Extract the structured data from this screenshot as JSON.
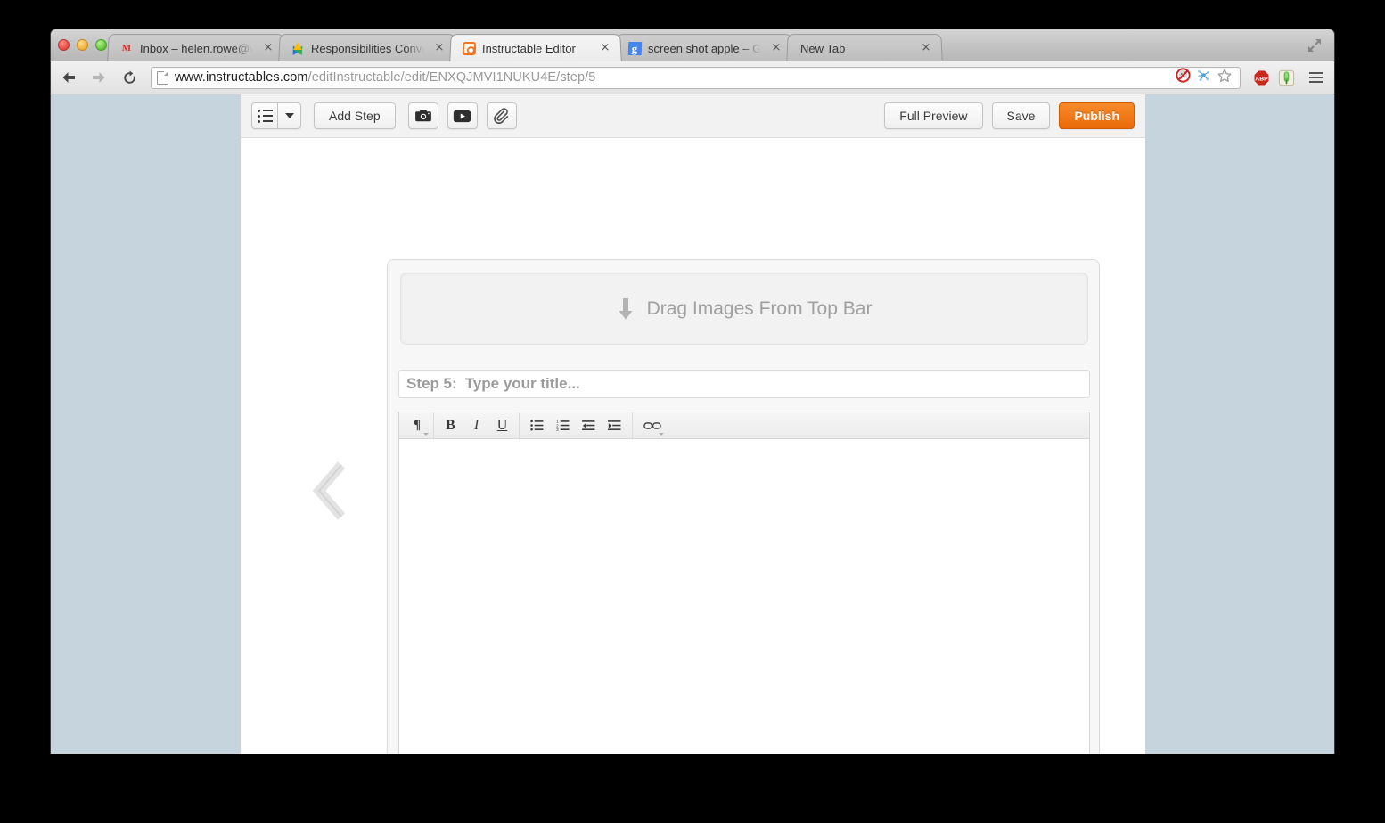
{
  "browser": {
    "window_controls": [
      "close",
      "minimize",
      "zoom"
    ],
    "fullscreen_icon": "fullscreen-expand-icon",
    "tabs": [
      {
        "title": "Inbox – helen.rowe@works",
        "favicon": "gmail-icon",
        "active": false,
        "close_label": "×"
      },
      {
        "title": "Responsibilities Conventio",
        "favicon": "google-drive-icon",
        "active": false,
        "close_label": "×"
      },
      {
        "title": "Instructable Editor",
        "favicon": "instructables-icon",
        "active": true,
        "close_label": "×"
      },
      {
        "title": "screen shot apple – Google",
        "favicon": "google-icon",
        "active": false,
        "close_label": "×"
      },
      {
        "title": "New Tab",
        "favicon": "none",
        "active": false,
        "close_label": "×"
      }
    ],
    "nav": {
      "back_icon": "back-arrow-icon",
      "forward_icon": "forward-arrow-icon",
      "reload_icon": "reload-icon"
    },
    "omnibox": {
      "page_icon": "page-document-icon",
      "url_host": "www.instructables.com",
      "url_path": "/editInstructable/edit/ENXQJMVI1NUKU4E/step/5",
      "full_url": "www.instructables.com/editInstructable/edit/ENXQJMVI1NUKU4E/step/5",
      "inline_icons": [
        "ghostery-icon",
        "collusion-icon",
        "bookmark-star-icon"
      ]
    },
    "extensions": [
      {
        "name": "adblock-plus-icon",
        "label": "ABP",
        "color": "#c9291d"
      },
      {
        "name": "evernote-clipper-icon",
        "label": "",
        "color": "#7ac143"
      }
    ],
    "menu_icon": "hamburger-menu-icon"
  },
  "editor_toolbar": {
    "list_view_icon": "bulleted-list-icon",
    "list_view_caret_icon": "chevron-down-icon",
    "add_step_label": "Add Step",
    "camera_icon": "camera-icon",
    "video_icon": "video-play-icon",
    "attach_icon": "paperclip-icon",
    "full_preview_label": "Full Preview",
    "save_label": "Save",
    "publish_label": "Publish",
    "publish_color": "#ea6a09"
  },
  "step": {
    "dropzone": {
      "arrow_icon": "down-arrow-icon",
      "label": "Drag Images From Top Bar"
    },
    "title_field": {
      "prefix": "Step 5:",
      "placeholder": "Type your title..."
    },
    "rte": {
      "paragraph_icon": "pilcrow-icon",
      "paragraph_glyph": "¶",
      "bold_label": "B",
      "italic_label": "I",
      "underline_label": "U",
      "bullet_list_icon": "bulleted-list-icon",
      "numbered_list_icon": "numbered-list-icon",
      "outdent_icon": "outdent-icon",
      "indent_icon": "indent-icon",
      "link_icon": "link-chain-icon",
      "body_value": ""
    }
  },
  "navigation": {
    "prev_step_icon": "chevron-left-icon"
  },
  "colors": {
    "desktop_background": "#000000",
    "page_background": "#c6d5dd",
    "accent_orange": "#ea6a09",
    "panel_gray": "#f7f7f7"
  }
}
